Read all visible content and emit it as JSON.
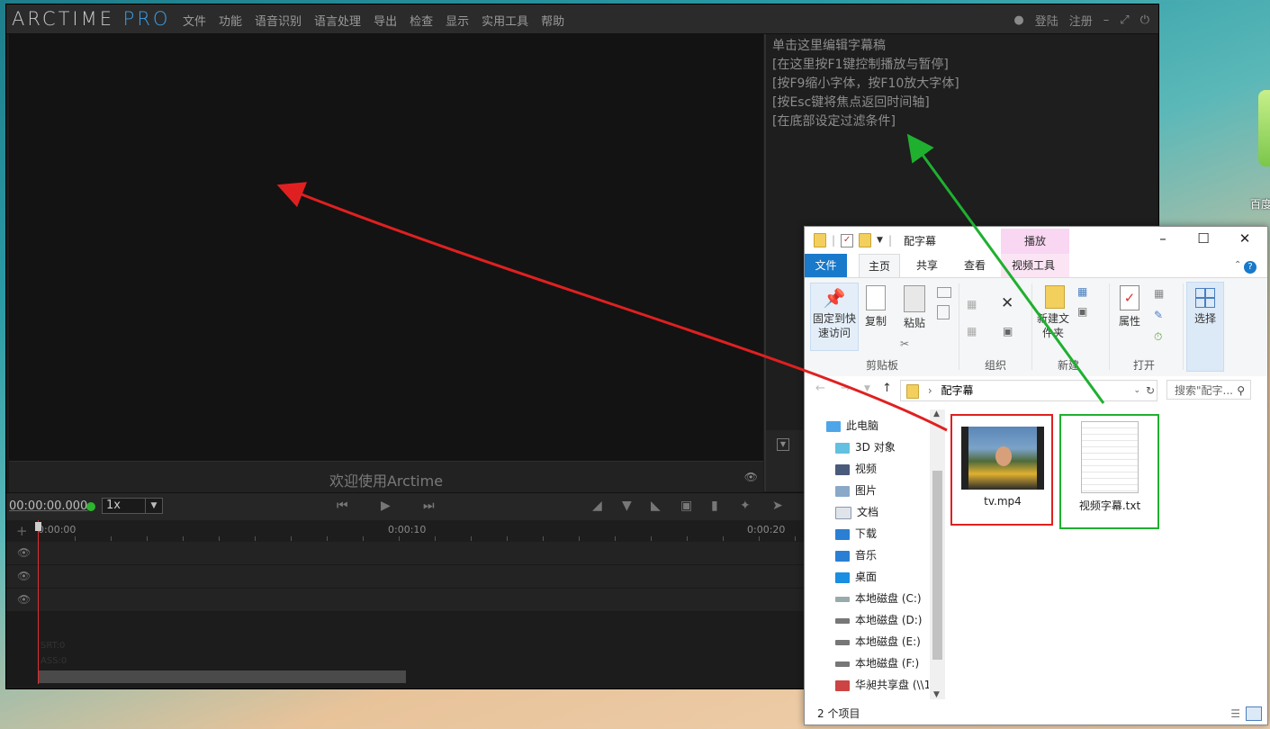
{
  "desktop": {
    "icon_label": "百度"
  },
  "arctime": {
    "logo_main": "ARCTIME",
    "logo_pro": "PRO",
    "menu": [
      "文件",
      "功能",
      "语音识别",
      "语言处理",
      "导出",
      "检查",
      "显示",
      "实用工具",
      "帮助"
    ],
    "login": "登陆",
    "register": "注册",
    "welcome": "欢迎使用Arctime",
    "editor_lines": [
      "单击这里编辑字幕稿",
      "[在这里按F1键控制播放与暂停]",
      "[按F9缩小字体，按F10放大字体]",
      "[按Esc键将焦点返回时间轴]",
      "[在底部设定过滤条件]"
    ],
    "timecode": "00:00:00.000",
    "speed": "1x",
    "ruler_labels": [
      "0:00:00",
      "0:00:10",
      "0:00:20"
    ],
    "ghost_texts": [
      "SRT:0",
      "ASS:0"
    ]
  },
  "explorer": {
    "title": "配字幕",
    "context_tab": "播放",
    "tabs": [
      "文件",
      "主页",
      "共享",
      "查看",
      "视频工具"
    ],
    "ribbon": {
      "pin": "固定到快速访问",
      "copy": "复制",
      "paste": "粘贴",
      "group_clipboard": "剪贴板",
      "group_organize": "组织",
      "new_folder": "新建文件夹",
      "group_new": "新建",
      "properties": "属性",
      "group_open": "打开",
      "select": "选择"
    },
    "address": "配字幕",
    "search_placeholder": "搜索\"配字...",
    "nav": [
      "此电脑",
      "3D 对象",
      "视频",
      "图片",
      "文档",
      "下载",
      "音乐",
      "桌面",
      "本地磁盘 (C:)",
      "本地磁盘 (D:)",
      "本地磁盘 (E:)",
      "本地磁盘 (F:)",
      "华昶共享盘 (\\\\1"
    ],
    "files": [
      {
        "name": "tv.mp4",
        "kind": "video-thumbnail"
      },
      {
        "name": "视频字幕.txt",
        "kind": "text-document"
      }
    ],
    "status": "2 个项目"
  },
  "colors": {
    "arctime_pro": "#3aa0e8",
    "red_arrow": "#e02020",
    "green_arrow": "#1fb02f",
    "file_tab": "#1979ca",
    "play_tab": "#f9d6f1"
  }
}
